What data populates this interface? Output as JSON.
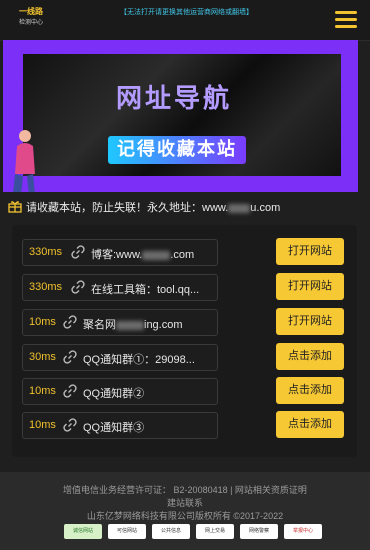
{
  "header": {
    "logo_main": "一线路",
    "logo_sub": "检测中心",
    "notice": "【无法打开请更换其他运营商网络或翻墙】",
    "accent": "#f4c430"
  },
  "banner": {
    "title": "网址导航",
    "subtitle": "记得收藏本站",
    "border_color": "#7b2ff7"
  },
  "announcement": {
    "text": "请收藏本站，防止失联！永久地址：www."
  },
  "links": [
    {
      "ms": "330ms",
      "site": "博客:www.",
      "site_tail": ".com",
      "button": "打开网站"
    },
    {
      "ms": "330ms",
      "site": "在线工具箱：tool.qq...",
      "site_tail": "",
      "button": "打开网站"
    },
    {
      "ms": "10ms",
      "site": "聚名网",
      "site_tail": "ing.com",
      "button": "打开网站"
    },
    {
      "ms": "30ms",
      "site": "QQ通知群①：29098...",
      "site_tail": "",
      "button": "点击添加"
    },
    {
      "ms": "10ms",
      "site": "QQ通知群②",
      "site_tail": "",
      "button": "点击添加"
    },
    {
      "ms": "10ms",
      "site": "QQ通知群③",
      "site_tail": "",
      "button": "点击添加"
    }
  ],
  "footer": {
    "license": "增值电信业务经营许可证：  B2-20080418 | 网站相关资质证明",
    "contact": "建站联系",
    "copyright": "山东亿梦网络科技有限公司版权所有 ©2017-2022",
    "badges": [
      "诚信网站",
      "可信网站",
      "公共信息",
      "网上交易",
      "网络警察",
      "举报中心"
    ]
  }
}
